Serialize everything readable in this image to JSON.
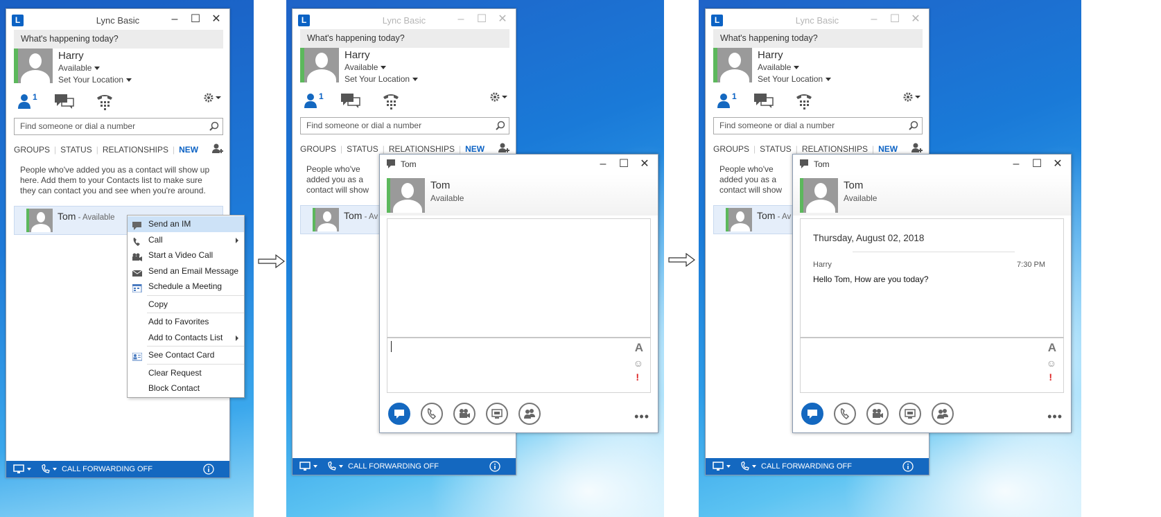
{
  "app_title": "Lync Basic",
  "note_placeholder": "What's happening today?",
  "me": {
    "name": "Harry",
    "status": "Available",
    "location": "Set Your Location"
  },
  "contacts_count": "1",
  "search_placeholder": "Find someone or dial a number",
  "tabs": {
    "groups": "GROUPS",
    "status": "STATUS",
    "relationships": "RELATIONSHIPS",
    "new": "NEW"
  },
  "info_text": "People who've added you as a contact will show up here. Add them to your Contacts list to make sure they can contact you and see when you're around.",
  "info_text_truncated": "People who've added you as a contact will show up here. Add them to yo can contact you and",
  "contact": {
    "name": "Tom",
    "status_suffix": " - Available",
    "status_suffix_cut": " - Av"
  },
  "status_bar": {
    "call_forwarding": "CALL FORWARDING OFF"
  },
  "context_menu": [
    {
      "label": "Send an IM",
      "icon": "chat-bubble-icon",
      "highlight": true
    },
    {
      "label": "Call",
      "icon": "phone-icon",
      "submenu": true
    },
    {
      "label": "Start a Video Call",
      "icon": "video-camera-icon"
    },
    {
      "label": "Send an Email Message",
      "icon": "envelope-icon"
    },
    {
      "label": "Schedule a Meeting",
      "icon": "calendar-icon"
    },
    {
      "label": "Copy"
    },
    {
      "label": "Add to Favorites"
    },
    {
      "label": "Add to Contacts List",
      "submenu": true
    },
    {
      "label": "See Contact Card",
      "icon": "contact-card-icon"
    },
    {
      "label": "Clear Request"
    },
    {
      "label": "Block Contact"
    }
  ],
  "conversation": {
    "title": "Tom",
    "name": "Tom",
    "status": "Available",
    "date": "Thursday, August 02, 2018",
    "sender": "Harry",
    "time": "7:30 PM",
    "message": "Hello Tom, How are you today?"
  }
}
